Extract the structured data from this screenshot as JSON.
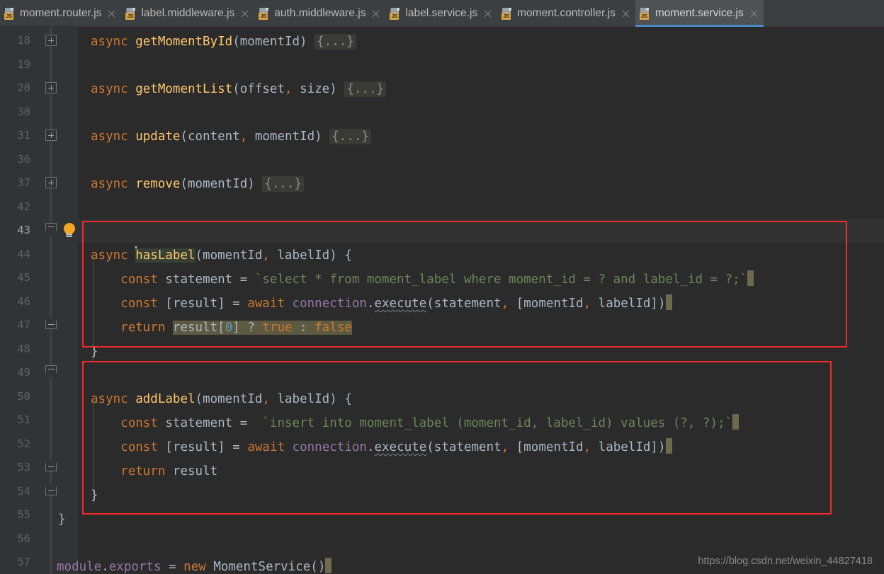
{
  "window": {
    "app": "IntelliJ IDEA / WebStorm editor",
    "background": "#2b2b2b"
  },
  "tabbar": {
    "tabs": [
      {
        "label": "moment.router.js",
        "icon": "js-file-icon",
        "badge": "JS",
        "active": false,
        "close_icon": "close-icon"
      },
      {
        "label": "label.middleware.js",
        "icon": "js-file-icon",
        "badge": "JS",
        "active": false,
        "close_icon": "close-icon"
      },
      {
        "label": "auth.middleware.js",
        "icon": "js-file-icon",
        "badge": "JS",
        "active": false,
        "close_icon": "close-icon"
      },
      {
        "label": "label.service.js",
        "icon": "js-file-icon",
        "badge": "JS",
        "active": false,
        "close_icon": "close-icon"
      },
      {
        "label": "moment.controller.js",
        "icon": "js-file-icon",
        "badge": "JS",
        "active": false,
        "close_icon": "close-icon"
      },
      {
        "label": "moment.service.js",
        "icon": "js-file-icon",
        "badge": "JS",
        "active": true,
        "close_icon": "close-icon"
      }
    ],
    "active_tab": "moment.service.js",
    "active_underline_color": "#4a88c7"
  },
  "gutter": {
    "line_numbers": [
      "18",
      "19",
      "20",
      "30",
      "31",
      "36",
      "37",
      "42",
      "43",
      "44",
      "45",
      "46",
      "47",
      "48",
      "49",
      "50",
      "51",
      "52",
      "53",
      "54",
      "55",
      "56",
      "57"
    ],
    "current_line": "43",
    "fold_markers": [
      {
        "line": "18",
        "type": "plus"
      },
      {
        "line": "20",
        "type": "plus"
      },
      {
        "line": "31",
        "type": "plus"
      },
      {
        "line": "37",
        "type": "plus"
      },
      {
        "line": "43",
        "type": "minus"
      },
      {
        "line": "47",
        "type": "end"
      },
      {
        "line": "49",
        "type": "minus"
      },
      {
        "line": "53",
        "type": "end"
      },
      {
        "line": "54",
        "type": "end"
      }
    ],
    "intention_bulb": {
      "line": "43",
      "icon": "lightbulb-icon",
      "color": "#f5a623"
    }
  },
  "code": {
    "language": "javascript",
    "lines": [
      {
        "n": "18",
        "text": "    async getMomentById(momentId) {...}"
      },
      {
        "n": "19",
        "text": ""
      },
      {
        "n": "20",
        "text": "    async getMomentList(offset, size) {...}"
      },
      {
        "n": "30",
        "text": ""
      },
      {
        "n": "31",
        "text": "    async update(content, momentId) {...}"
      },
      {
        "n": "36",
        "text": ""
      },
      {
        "n": "37",
        "text": "    async remove(momentId) {...}"
      },
      {
        "n": "42",
        "text": ""
      },
      {
        "n": "43",
        "text": "    async hasLabel(momentId, labelId) {"
      },
      {
        "n": "44",
        "text": "        const statement = `select * from moment_label where moment_id = ? and label_id = ?;`"
      },
      {
        "n": "45",
        "text": "        const [result] = await connection.execute(statement, [momentId, labelId])"
      },
      {
        "n": "46",
        "text": "        return result[0] ? true : false"
      },
      {
        "n": "47",
        "text": "    }"
      },
      {
        "n": "48",
        "text": ""
      },
      {
        "n": "49",
        "text": "    async addLabel(momentId, labelId) {"
      },
      {
        "n": "50",
        "text": "        const statement =  `insert into moment_label (moment_id, label_id) values (?, ?);`"
      },
      {
        "n": "51",
        "text": "        const [result] = await connection.execute(statement, [momentId, labelId])"
      },
      {
        "n": "52",
        "text": "        return result"
      },
      {
        "n": "53",
        "text": "    }"
      },
      {
        "n": "54",
        "text": "}"
      },
      {
        "n": "55",
        "text": ""
      },
      {
        "n": "56",
        "text": "module.exports = new MomentService()"
      },
      {
        "n": "57",
        "text": ""
      }
    ],
    "tokens": {
      "kw_async": "async",
      "kw_const": "const",
      "kw_await": "await",
      "kw_return": "return",
      "kw_new": "new",
      "kw_true": "true",
      "kw_false": "false",
      "fn_getMomentById": "getMomentById",
      "fn_getMomentList": "getMomentList",
      "fn_update": "update",
      "fn_remove": "remove",
      "fn_hasLabel": "hasLabel",
      "fn_addLabel": "addLabel",
      "fn_execute": "execute",
      "id_momentId": "momentId",
      "id_labelId": "labelId",
      "id_offset": "offset",
      "id_size": "size",
      "id_content": "content",
      "id_statement": "statement",
      "id_result": "result",
      "id_connection": "connection",
      "id_module": "module",
      "id_exports": "exports",
      "id_MomentService": "MomentService",
      "fold_placeholder": "{...}",
      "sql_select": "`select * from moment_label where moment_id = ? and label_id = ?;`",
      "sql_insert": "`insert into moment_label (moment_id, label_id) values (?, ?);`"
    },
    "selection": {
      "identifier_highlight": "hasLabel",
      "block_highlight": "result[0] ? true : false"
    }
  },
  "annotations": {
    "boxes": [
      {
        "name": "hasLabel-highlight-box",
        "color": "#f42a2a",
        "target": "hasLabel function"
      },
      {
        "name": "addLabel-highlight-box",
        "color": "#f42a2a",
        "target": "addLabel function"
      }
    ]
  },
  "watermark": {
    "text": "https://blog.csdn.net/weixin_44827418"
  }
}
